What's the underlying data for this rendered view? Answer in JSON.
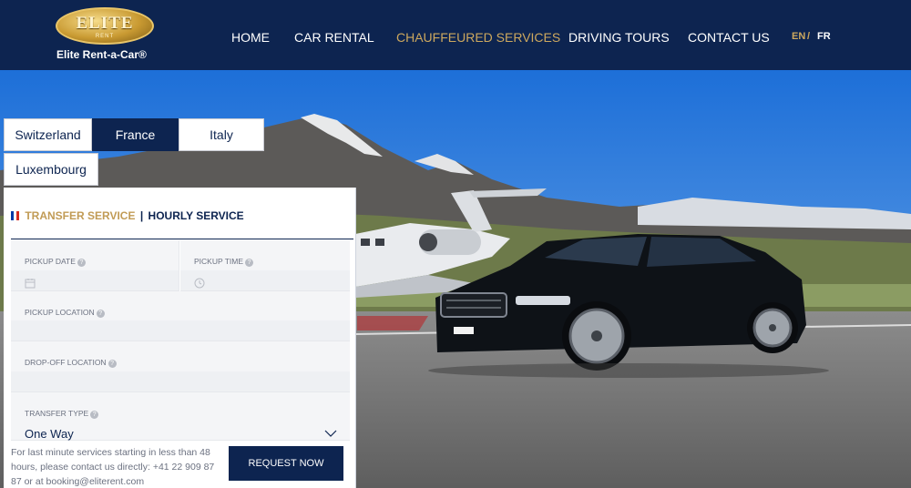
{
  "header": {
    "logo_text": "ELITE",
    "logo_subtext": "RENT",
    "brand": "Elite Rent-a-Car®",
    "nav": [
      "HOME",
      "CAR RENTAL",
      "CHAUFFEURED SERVICES",
      "DRIVING TOURS",
      "CONTACT US"
    ],
    "active_nav": "CHAUFFEURED SERVICES",
    "lang_en": "EN",
    "lang_sep": "/",
    "lang_fr": "FR"
  },
  "countries": {
    "tabs": [
      "Switzerland",
      "France",
      "Italy",
      "Luxembourg"
    ],
    "selected": "France"
  },
  "service": {
    "transfer": "TRANSFER SERVICE",
    "separator": "|",
    "hourly": "HOURLY SERVICE",
    "selected": "TRANSFER SERVICE"
  },
  "form": {
    "pickup_date_label": "PICKUP DATE",
    "pickup_time_label": "PICKUP TIME",
    "pickup_location_label": "PICKUP LOCATION",
    "dropoff_location_label": "DROP-OFF LOCATION",
    "transfer_type_label": "TRANSFER TYPE",
    "transfer_type_value": "One Way",
    "help_glyph": "?"
  },
  "note": "For last minute services starting in less than 48 hours, please contact us directly: +41 22 909 87 87 or at booking@eliterent.com",
  "request_button": "REQUEST NOW",
  "colors": {
    "navy": "#0d2450",
    "gold": "#cda85e",
    "transfer_gold": "#c19b55"
  },
  "icons": {
    "calendar": "calendar-icon",
    "clock": "clock-icon",
    "chevron": "chevron-down-icon",
    "help": "help-icon"
  }
}
